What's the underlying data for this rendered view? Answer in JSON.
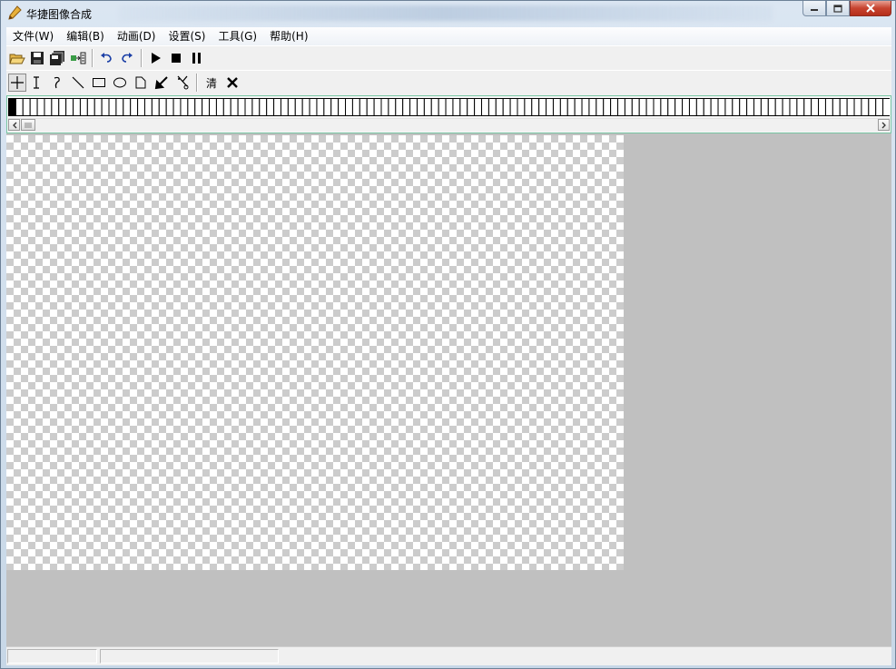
{
  "window": {
    "title": "华捷图像合成",
    "buttons": {
      "minimize": "minimize",
      "maximize": "maximize",
      "close": "close"
    }
  },
  "menu": [
    {
      "label": "文件(W)"
    },
    {
      "label": "编辑(B)"
    },
    {
      "label": "动画(D)"
    },
    {
      "label": "设置(S)"
    },
    {
      "label": "工具(G)"
    },
    {
      "label": "帮助(H)"
    }
  ],
  "toolbar1": {
    "buttons": [
      "open-icon",
      "save-icon",
      "save-all-icon",
      "import-icon",
      "undo-icon",
      "redo-icon",
      "play-icon",
      "stop-icon",
      "pause-icon"
    ]
  },
  "toolbar2": {
    "buttons": [
      "crosshair-icon",
      "ibeam-icon",
      "curve-icon",
      "line-icon",
      "rectangle-icon",
      "ellipse-icon",
      "polygon-icon",
      "fill-arrow-icon",
      "scissors-icon"
    ],
    "clear_label": "清",
    "delete_icon": "x-icon"
  },
  "framestrip": {
    "frame_count": 123,
    "selected_index": 0
  },
  "status": {
    "pane1": "",
    "pane2": ""
  },
  "colors": {
    "canvas_check": "#cccccc",
    "workspace": "#c0c0c0",
    "frame_border": "#78c6a3"
  }
}
